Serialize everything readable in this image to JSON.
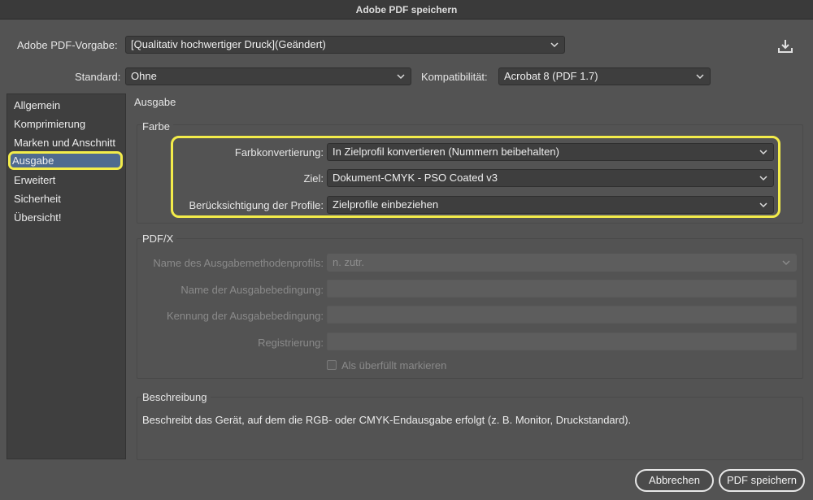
{
  "window": {
    "title": "Adobe PDF speichern"
  },
  "preset": {
    "label": "Adobe PDF-Vorgabe:",
    "value": "[Qualitativ hochwertiger Druck](Geändert)"
  },
  "standard": {
    "label": "Standard:",
    "value": "Ohne"
  },
  "compatibility": {
    "label": "Kompatibilität:",
    "value": "Acrobat 8 (PDF 1.7)"
  },
  "sidebar": {
    "items": [
      {
        "label": "Allgemein"
      },
      {
        "label": "Komprimierung"
      },
      {
        "label": "Marken und Anschnitt"
      },
      {
        "label": "Ausgabe"
      },
      {
        "label": "Erweitert"
      },
      {
        "label": "Sicherheit"
      },
      {
        "label": "Übersicht!"
      }
    ],
    "selected": "Ausgabe"
  },
  "main": {
    "section_title": "Ausgabe",
    "farbe": {
      "title": "Farbe",
      "conversion": {
        "label": "Farbkonvertierung:",
        "value": "In Zielprofil konvertieren (Nummern beibehalten)"
      },
      "destination": {
        "label": "Ziel:",
        "value": "Dokument-CMYK - PSO Coated v3"
      },
      "profile_inclusion": {
        "label": "Berücksichtigung der Profile:",
        "value": "Zielprofile einbeziehen"
      }
    },
    "pdfx": {
      "title": "PDF/X",
      "output_intent_profile": {
        "label": "Name des Ausgabemethodenprofils:",
        "value": "n. zutr."
      },
      "output_condition_name": {
        "label": "Name der Ausgabebedingung:",
        "value": ""
      },
      "output_condition_id": {
        "label": "Kennung der Ausgabebedingung:",
        "value": ""
      },
      "registry": {
        "label": "Registrierung:",
        "value": ""
      },
      "mark_trapped": {
        "label": "Als überfüllt markieren",
        "checked": false
      }
    },
    "description": {
      "title": "Beschreibung",
      "text": "Beschreibt das Gerät, auf dem die RGB- oder CMYK-Endausgabe erfolgt (z. B. Monitor, Druckstandard)."
    }
  },
  "buttons": {
    "cancel": "Abbrechen",
    "save": "PDF speichern"
  },
  "colors": {
    "highlight": "#f3ec4a",
    "selected_bg": "#4f6a8f",
    "dialog_bg": "#535353"
  }
}
